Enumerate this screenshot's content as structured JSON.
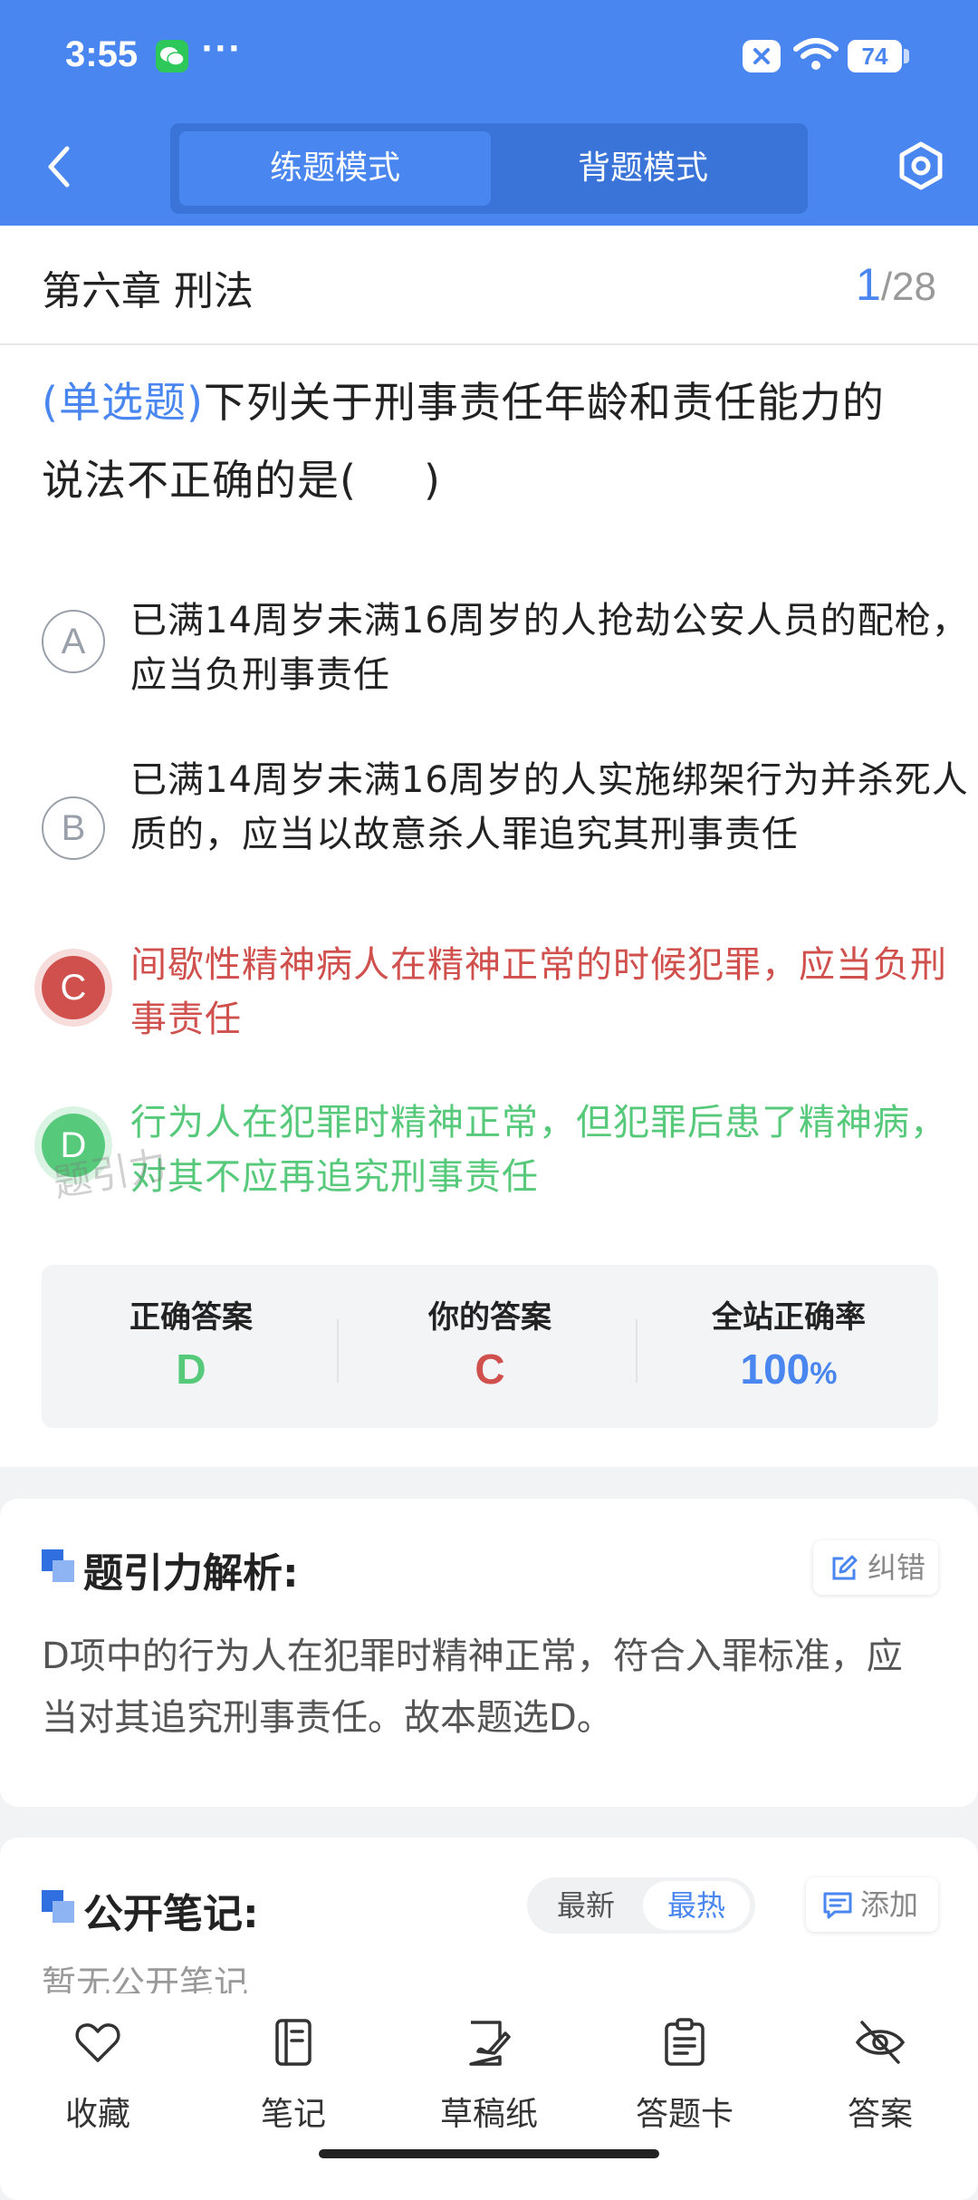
{
  "status_bar": {
    "time": "3:55",
    "dots": "···",
    "battery": "74"
  },
  "header": {
    "tabs": [
      {
        "label": "练题模式",
        "active": true
      },
      {
        "label": "背题模式",
        "active": false
      }
    ]
  },
  "chapter": {
    "title": "第六章 刑法",
    "current": "1",
    "total": "/28"
  },
  "question": {
    "type": "(单选题)",
    "text_line1": "下列关于刑事责任年龄和责任能力的",
    "text_line2": "说法不正确的是(",
    "text_close": ")",
    "options": [
      {
        "letter": "A",
        "text": "已满14周岁未满16周岁的人抢劫公安人员的配枪，应当负刑事责任",
        "state": "normal"
      },
      {
        "letter": "B",
        "text": "已满14周岁未满16周岁的人实施绑架行为并杀死人质的，应当以故意杀人罪追究其刑事责任",
        "state": "normal"
      },
      {
        "letter": "C",
        "text": "间歇性精神病人在精神正常的时候犯罪，应当负刑事责任",
        "state": "wrong"
      },
      {
        "letter": "D",
        "text": "行为人在犯罪时精神正常，但犯罪后患了精神病，对其不应再追究刑事责任",
        "state": "correct"
      }
    ],
    "watermark": "题引力"
  },
  "answer_summary": {
    "correct_label": "正确答案",
    "correct_value": "D",
    "yours_label": "你的答案",
    "yours_value": "C",
    "rate_label": "全站正确率",
    "rate_value": "100",
    "rate_unit": "%"
  },
  "analysis": {
    "title": "题引力解析:",
    "report_label": "纠错",
    "text": "D项中的行为人在犯罪时精神正常，符合入罪标准，应当对其追究刑事责任。故本题选D。"
  },
  "notes": {
    "title": "公开笔记:",
    "sort_latest": "最新",
    "sort_hot": "最热",
    "add_label": "添加",
    "empty_text": "暂无公开笔记"
  },
  "bottom_bar": {
    "items": [
      {
        "label": "收藏",
        "icon": "heart-icon"
      },
      {
        "label": "笔记",
        "icon": "notebook-icon"
      },
      {
        "label": "草稿纸",
        "icon": "draft-icon"
      },
      {
        "label": "答题卡",
        "icon": "answer-card-icon"
      },
      {
        "label": "答案",
        "icon": "eye-off-icon"
      }
    ]
  },
  "colors": {
    "brand": "#4a86f0",
    "wrong": "#d0504d",
    "correct": "#56c97a"
  }
}
